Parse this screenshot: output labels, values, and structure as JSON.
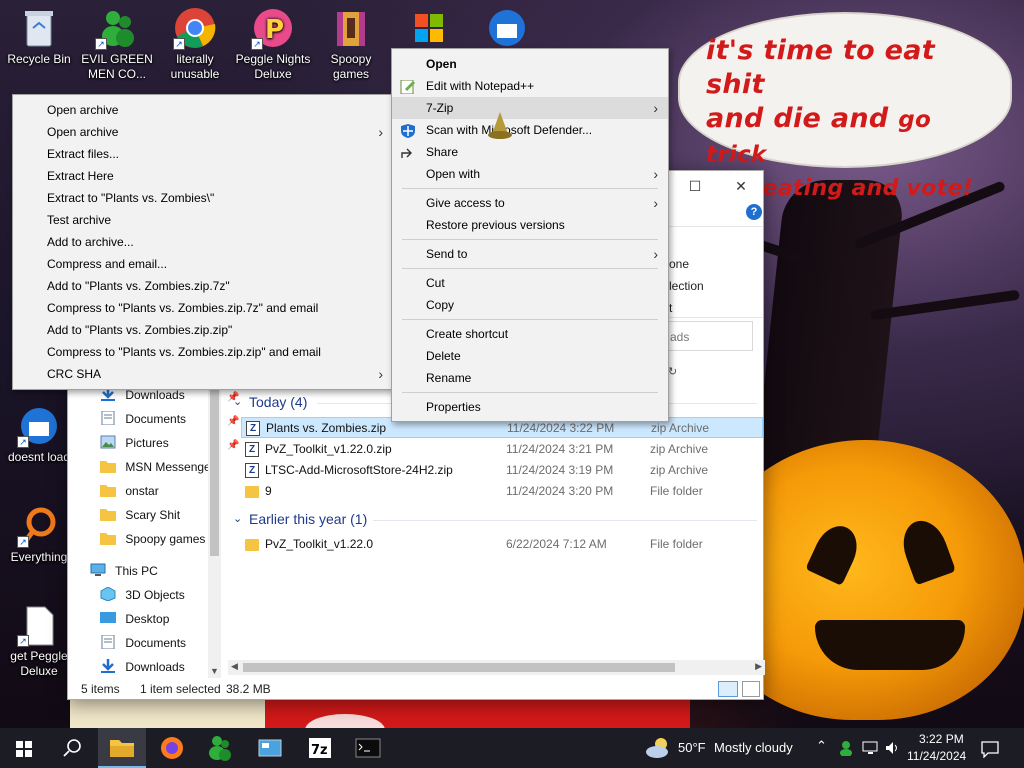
{
  "desktop": {
    "icons": [
      {
        "label": "Recycle Bin",
        "icon": "recycle-bin-icon"
      },
      {
        "label": "EVIL GREEN MEN CO...",
        "icon": "msn-people-icon"
      },
      {
        "label": "literally unusable",
        "icon": "chrome-icon"
      },
      {
        "label": "Peggle Nights Deluxe",
        "icon": "peggle-icon"
      },
      {
        "label": "Spoopy games",
        "icon": "winrar-icon"
      },
      {
        "label": "doesnt load",
        "icon": "thunderbird-icon"
      },
      {
        "label": "Everything",
        "icon": "everything-search-icon"
      },
      {
        "label": "get Peggle Deluxe",
        "icon": "text-file-icon"
      }
    ],
    "speech_bubble": {
      "line1": "it's time to eat shit",
      "line2": "and die and",
      "line2b": "go trick",
      "line3": "or treating and vote!"
    }
  },
  "explorer": {
    "ribbon_fragments": [
      "one",
      "lection",
      "t"
    ],
    "search_placeholder": "ads",
    "sort_icon": "refresh-icon",
    "nav_items": [
      {
        "label": "Downloads",
        "icon": "downloads-icon",
        "pinned": true
      },
      {
        "label": "Documents",
        "icon": "documents-icon",
        "pinned": true
      },
      {
        "label": "Pictures",
        "icon": "pictures-icon",
        "pinned": true
      },
      {
        "label": "MSN Messenger",
        "icon": "folder-icon"
      },
      {
        "label": "onstar",
        "icon": "folder-icon"
      },
      {
        "label": "Scary Shit",
        "icon": "folder-icon"
      },
      {
        "label": "Spoopy games",
        "icon": "folder-icon"
      },
      {
        "label": "This PC",
        "icon": "this-pc-icon"
      },
      {
        "label": "3D Objects",
        "icon": "3d-objects-icon"
      },
      {
        "label": "Desktop",
        "icon": "desktop-icon"
      },
      {
        "label": "Documents",
        "icon": "documents-icon"
      },
      {
        "label": "Downloads",
        "icon": "downloads-icon"
      }
    ],
    "groups": [
      {
        "title": "Today (4)",
        "files": [
          {
            "name": "Plants vs. Zombies.zip",
            "date": "11/24/2024 3:22 PM",
            "type": "zip Archive",
            "kind": "zip",
            "selected": true
          },
          {
            "name": "PvZ_Toolkit_v1.22.0.zip",
            "date": "11/24/2024 3:21 PM",
            "type": "zip Archive",
            "kind": "zip"
          },
          {
            "name": "LTSC-Add-MicrosoftStore-24H2.zip",
            "date": "11/24/2024 3:19 PM",
            "type": "zip Archive",
            "kind": "zip"
          },
          {
            "name": "9",
            "date": "11/24/2024 3:20 PM",
            "type": "File folder",
            "kind": "folder"
          }
        ]
      },
      {
        "title": "Earlier this year (1)",
        "files": [
          {
            "name": "PvZ_Toolkit_v1.22.0",
            "date": "6/22/2024 7:12 AM",
            "type": "File folder",
            "kind": "folder"
          }
        ]
      }
    ],
    "status": {
      "items": "5 items",
      "selected": "1 item selected",
      "size": "38.2 MB"
    }
  },
  "context_menu": {
    "items": [
      {
        "label": "Open",
        "bold": true
      },
      {
        "label": "Edit with Notepad++",
        "icon": "notepad-plus-plus-icon"
      },
      {
        "label": "7-Zip",
        "submenu": true,
        "hover": true
      },
      {
        "label": "Scan with Microsoft Defender...",
        "icon": "defender-icon"
      },
      {
        "label": "Share",
        "icon": "share-icon"
      },
      {
        "label": "Open with",
        "submenu": true
      },
      {
        "separator": true
      },
      {
        "label": "Give access to",
        "submenu": true
      },
      {
        "label": "Restore previous versions"
      },
      {
        "separator": true
      },
      {
        "label": "Send to",
        "submenu": true
      },
      {
        "separator": true
      },
      {
        "label": "Cut"
      },
      {
        "label": "Copy"
      },
      {
        "separator": true
      },
      {
        "label": "Create shortcut"
      },
      {
        "label": "Delete"
      },
      {
        "label": "Rename"
      },
      {
        "separator": true
      },
      {
        "label": "Properties"
      }
    ]
  },
  "sevenzip_menu": {
    "items": [
      {
        "label": "Open archive"
      },
      {
        "label": "Open archive",
        "submenu": true
      },
      {
        "label": "Extract files..."
      },
      {
        "label": "Extract Here"
      },
      {
        "label": "Extract to \"Plants vs. Zombies\\\""
      },
      {
        "label": "Test archive"
      },
      {
        "label": "Add to archive..."
      },
      {
        "label": "Compress and email..."
      },
      {
        "label": "Add to \"Plants vs. Zombies.zip.7z\""
      },
      {
        "label": "Compress to \"Plants vs. Zombies.zip.7z\" and email"
      },
      {
        "label": "Add to \"Plants vs. Zombies.zip.zip\""
      },
      {
        "label": "Compress to \"Plants vs. Zombies.zip.zip\" and email"
      },
      {
        "label": "CRC SHA",
        "submenu": true
      }
    ]
  },
  "taskbar": {
    "apps": [
      {
        "name": "start",
        "icon": "windows-start-icon"
      },
      {
        "name": "search",
        "icon": "search-icon"
      },
      {
        "name": "file-explorer",
        "icon": "file-explorer-icon",
        "active": true
      },
      {
        "name": "firefox",
        "icon": "firefox-icon"
      },
      {
        "name": "msn-messenger",
        "icon": "msn-messenger-icon"
      },
      {
        "name": "control-panel",
        "icon": "control-panel-icon"
      },
      {
        "name": "7zip",
        "icon": "7zip-icon"
      },
      {
        "name": "terminal",
        "icon": "terminal-icon"
      }
    ],
    "weather": {
      "temp": "50°F",
      "condition": "Mostly cloudy",
      "icon": "cloudy-moon-icon"
    },
    "clock": {
      "time": "3:22 PM",
      "date": "11/24/2024"
    }
  },
  "colors": {
    "accent": "#0078d7",
    "selection": "#cce8ff",
    "bubble_text": "#d21a1a"
  }
}
